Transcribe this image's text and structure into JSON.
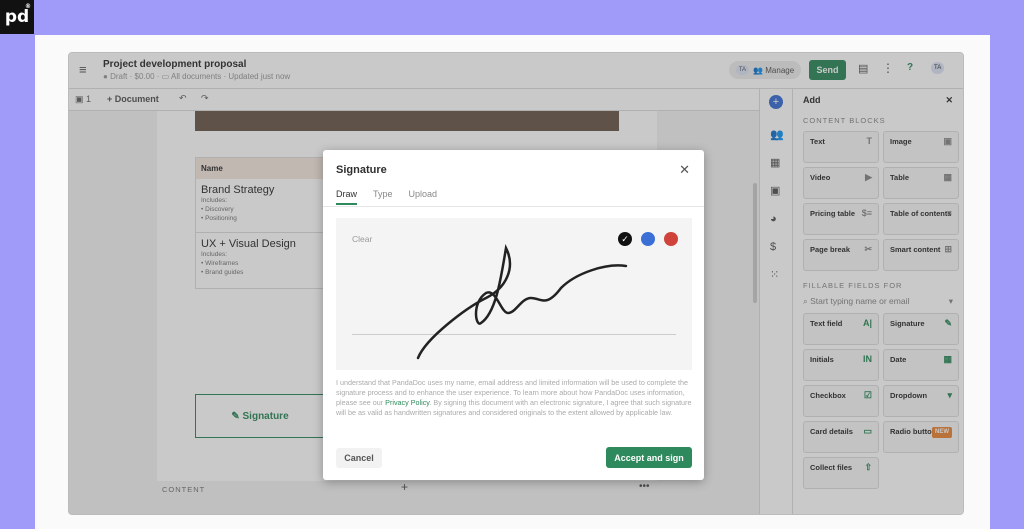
{
  "logo": "pd",
  "header": {
    "title": "Project development proposal",
    "status": "Draft",
    "price": "$0.00",
    "folder": "All documents",
    "updated": "Updated just now",
    "avatar": "TA",
    "manage": "Manage",
    "send": "Send",
    "help": "?"
  },
  "toolbar": {
    "pages": "1",
    "document": "Document"
  },
  "doc": {
    "table_header": "Name",
    "rows": [
      {
        "title": "Brand Strategy",
        "includes": "Includes:",
        "items": [
          "Discovery",
          "Positioning"
        ]
      },
      {
        "title": "UX + Visual Design",
        "includes": "Includes:",
        "items": [
          "Wireframes",
          "Brand guides"
        ]
      }
    ],
    "signature": "Signature",
    "footer": "CONTENT"
  },
  "panel": {
    "title": "Add",
    "content_blocks": "CONTENT BLOCKS",
    "blocks": [
      {
        "label": "Text",
        "icon": "T"
      },
      {
        "label": "Image",
        "icon": "▣"
      },
      {
        "label": "Video",
        "icon": "▶"
      },
      {
        "label": "Table",
        "icon": "▦"
      },
      {
        "label": "Pricing table",
        "icon": "$≡"
      },
      {
        "label": "Table of contents",
        "icon": "≡"
      },
      {
        "label": "Page break",
        "icon": "✂"
      },
      {
        "label": "Smart content",
        "icon": "⊞"
      }
    ],
    "fillable": "FILLABLE FIELDS FOR",
    "search_placeholder": "Start typing name or email",
    "fields": [
      {
        "label": "Text field",
        "icon": "A|"
      },
      {
        "label": "Signature",
        "icon": "✎"
      },
      {
        "label": "Initials",
        "icon": "IN"
      },
      {
        "label": "Date",
        "icon": "▦"
      },
      {
        "label": "Checkbox",
        "icon": "☑"
      },
      {
        "label": "Dropdown",
        "icon": "▾"
      },
      {
        "label": "Card details",
        "icon": "▭"
      },
      {
        "label": "Radio buttons",
        "icon": "NEW"
      },
      {
        "label": "Collect files",
        "icon": "⇧"
      }
    ]
  },
  "modal": {
    "title": "Signature",
    "tabs": [
      "Draw",
      "Type",
      "Upload"
    ],
    "clear": "Clear",
    "colors": [
      "#111111",
      "#3b6fd6",
      "#d0433a"
    ],
    "legal_1": "I understand that PandaDoc uses my name, email address and limited information will be used to complete the signature process and to enhance the user experience. To learn more about how PandaDoc uses information, please see our ",
    "privacy": "Privacy Policy",
    "legal_2": ". By signing this document with an electronic signature, I agree that such signature will be as valid as handwritten signatures and considered originals to the extent allowed by applicable law.",
    "cancel": "Cancel",
    "accept": "Accept and sign"
  },
  "colors": {
    "accent": "#2e8a5c",
    "background": "#a09af8"
  }
}
